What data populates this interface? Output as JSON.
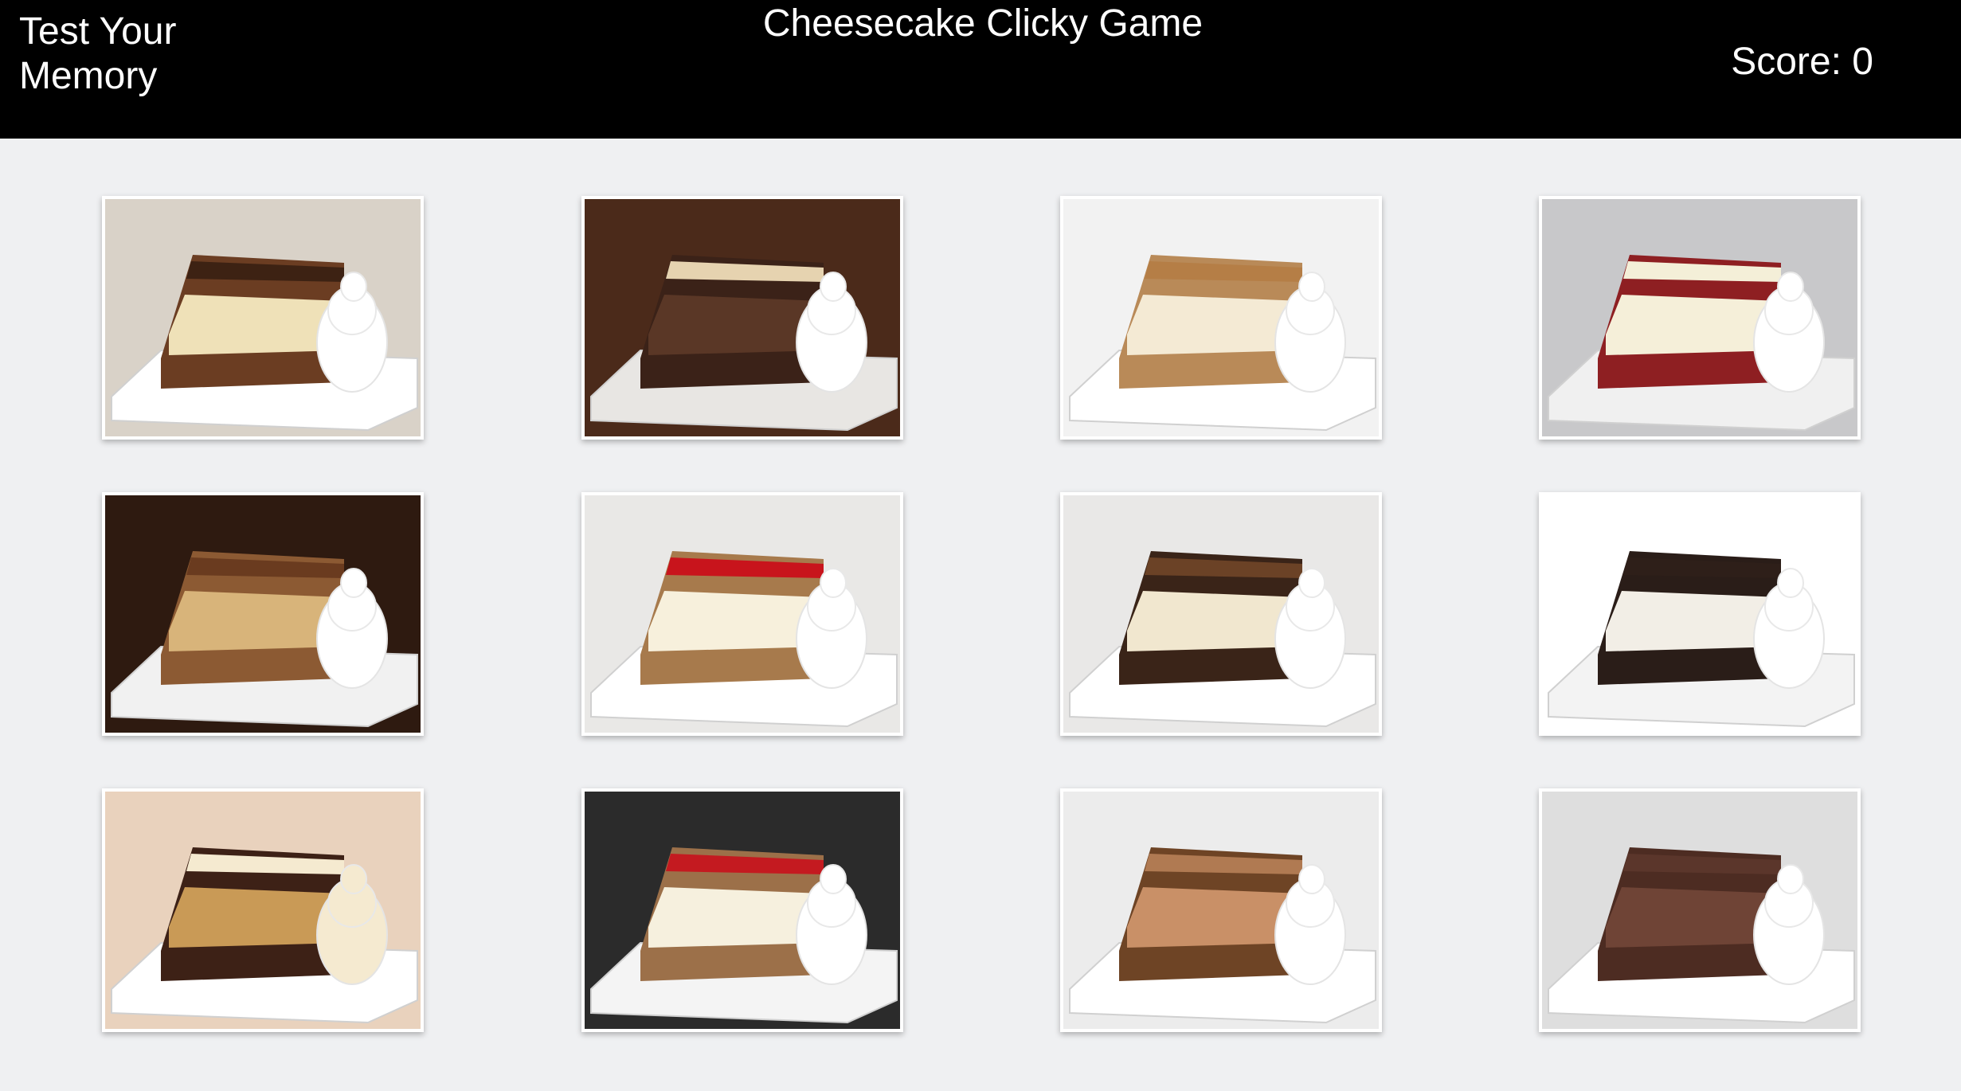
{
  "header": {
    "left_line1": "Test Your",
    "left_line2": "Memory",
    "title": "Cheesecake Clicky Game",
    "score_label": "Score:",
    "score_value": "0"
  },
  "cards": [
    {
      "name": "hersheys-chocolate-bar-cheesecake",
      "bg": "#d9d2c8",
      "plate": "#ffffff",
      "cake": "#6b3d22",
      "layer": "#efe1b8",
      "topping": "#3d2213",
      "cream": "#ffffff"
    },
    {
      "name": "smores-galore-cheesecake",
      "bg": "#4b2a1a",
      "plate": "#e8e6e3",
      "cake": "#3b2218",
      "layer": "#5a3726",
      "topping": "#e6d3b0",
      "cream": "#ffffff"
    },
    {
      "name": "dulce-de-leche-cheesecake",
      "bg": "#f2f2f2",
      "plate": "#ffffff",
      "cake": "#b98a58",
      "layer": "#f4ead4",
      "topping": "#b57e46",
      "cream": "#ffffff"
    },
    {
      "name": "red-velvet-cheesecake",
      "bg": "#c8c8ca",
      "plate": "#f0f0f0",
      "cake": "#8e1f22",
      "layer": "#f5efd9",
      "topping": "#f4efd8",
      "cream": "#ffffff"
    },
    {
      "name": "peanut-butter-cup-cheesecake",
      "bg": "#2e1a10",
      "plate": "#f1f1f1",
      "cake": "#8c5a33",
      "layer": "#d8b47a",
      "topping": "#6a3b1f",
      "cream": "#ffffff"
    },
    {
      "name": "fresh-strawberry-cheesecake",
      "bg": "#e9e8e6",
      "plate": "#ffffff",
      "cake": "#a77a4c",
      "layer": "#f7f0dc",
      "topping": "#c8141c",
      "cream": "#ffffff"
    },
    {
      "name": "chocolate-chip-cookie-dough-cheesecake",
      "bg": "#e9e8e7",
      "plate": "#ffffff",
      "cake": "#3a2418",
      "layer": "#f1e7cf",
      "topping": "#6b4226",
      "cream": "#ffffff"
    },
    {
      "name": "oreo-dream-extreme-cheesecake",
      "bg": "#ffffff",
      "plate": "#f3f3f3",
      "cake": "#2a1d18",
      "layer": "#f2eee6",
      "topping": "#2e1f19",
      "cream": "#ffffff"
    },
    {
      "name": "reeses-peanut-butter-chocolate-cake-cheesecake",
      "bg": "#e9d2bd",
      "plate": "#ffffff",
      "cake": "#3d2116",
      "layer": "#c99a56",
      "topping": "#f5ead0",
      "cream": "#f5ead0"
    },
    {
      "name": "original-strawberry-cheesecake",
      "bg": "#2b2b2b",
      "plate": "#f4f4f4",
      "cake": "#9c7049",
      "layer": "#f6f0de",
      "topping": "#c41a20",
      "cream": "#ffffff"
    },
    {
      "name": "pumpkin-pecan-cheesecake",
      "bg": "#ececec",
      "plate": "#ffffff",
      "cake": "#6e4425",
      "layer": "#c99067",
      "topping": "#b07a52",
      "cream": "#ffffff"
    },
    {
      "name": "chocolate-mousse-cheesecake",
      "bg": "#dedede",
      "plate": "#ffffff",
      "cake": "#4d2c22",
      "layer": "#6f4436",
      "topping": "#5b362b",
      "cream": "#ffffff"
    }
  ]
}
